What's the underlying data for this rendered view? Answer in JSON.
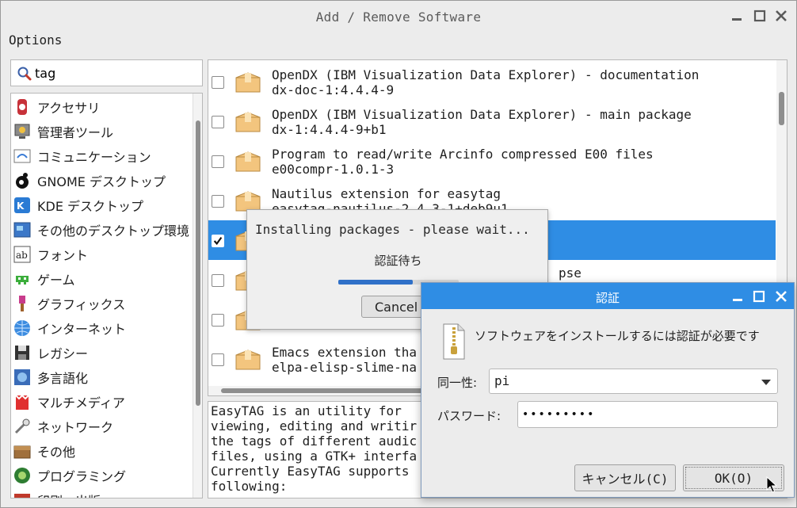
{
  "window": {
    "title": "Add / Remove Software",
    "menu": [
      "Options"
    ]
  },
  "search": {
    "value": "tag",
    "icon": "search-icon"
  },
  "categories": [
    {
      "label": "アクセサリ",
      "icon": "accessories-icon"
    },
    {
      "label": "管理者ツール",
      "icon": "admin-tools-icon"
    },
    {
      "label": "コミュニケーション",
      "icon": "communication-icon"
    },
    {
      "label": "GNOME デスクトップ",
      "icon": "gnome-icon"
    },
    {
      "label": "KDE デスクトップ",
      "icon": "kde-icon"
    },
    {
      "label": "その他のデスクトップ環境",
      "icon": "desktop-icon"
    },
    {
      "label": "フォント",
      "icon": "font-icon"
    },
    {
      "label": "ゲーム",
      "icon": "game-icon"
    },
    {
      "label": "グラフィックス",
      "icon": "graphics-icon"
    },
    {
      "label": "インターネット",
      "icon": "internet-icon"
    },
    {
      "label": "レガシー",
      "icon": "legacy-icon"
    },
    {
      "label": "多言語化",
      "icon": "localization-icon"
    },
    {
      "label": "マルチメディア",
      "icon": "multimedia-icon"
    },
    {
      "label": "ネットワーク",
      "icon": "network-icon"
    },
    {
      "label": "その他",
      "icon": "other-icon"
    },
    {
      "label": "プログラミング",
      "icon": "programming-icon"
    },
    {
      "label": "印刷・出版",
      "icon": "publishing-icon"
    }
  ],
  "packages": [
    {
      "name": "OpenDX (IBM Visualization Data Explorer) - documentation",
      "version": "dx-doc-1:4.4.4-9",
      "checked": false
    },
    {
      "name": "OpenDX (IBM Visualization Data Explorer) - main package",
      "version": "dx-1:4.4.4-9+b1",
      "checked": false
    },
    {
      "name": "Program to read/write Arcinfo compressed E00 files",
      "version": "e00compr-1.0.1-3",
      "checked": false
    },
    {
      "name": "Nautilus extension for easytag",
      "version": "easytag-nautilus-2.4.3-1+deb9u1",
      "checked": false
    },
    {
      "name": "",
      "version": "",
      "checked": true
    },
    {
      "name": "",
      "version": "",
      "checked": false
    },
    {
      "name": "",
      "version": "",
      "checked": false
    },
    {
      "name": "Emacs extension tha",
      "version": "elpa-elisp-slime-na",
      "checked": false
    }
  ],
  "package_partial": {
    "row5_tail": "pse"
  },
  "description": "EasyTAG is an utility for\nviewing, editing and writir\nthe tags of different audic\nfiles, using a GTK+ interfa\nCurrently EasyTAG supports\nfollowing:",
  "install_dialog": {
    "title": "Installing packages - please wait...",
    "status": "認証待ち",
    "progress": 0.62,
    "cancel_label": "Cancel"
  },
  "auth_dialog": {
    "title": "認証",
    "message": "ソフトウェアをインストールするには認証が必要です",
    "identity_label": "同一性:",
    "identity_value": "pi",
    "password_label": "パスワード:",
    "password_value": "•••••••••",
    "cancel_label": "キャンセル(C)",
    "ok_label": "OK(O)"
  },
  "colors": {
    "accent": "#2f8de4",
    "selection": "#2f8de4"
  }
}
